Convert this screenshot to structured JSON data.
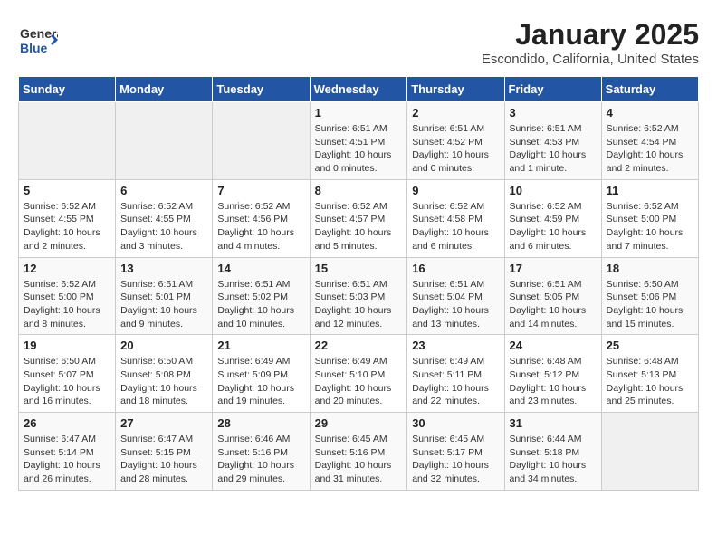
{
  "header": {
    "logo_general": "General",
    "logo_blue": "Blue",
    "month": "January 2025",
    "location": "Escondido, California, United States"
  },
  "weekdays": [
    "Sunday",
    "Monday",
    "Tuesday",
    "Wednesday",
    "Thursday",
    "Friday",
    "Saturday"
  ],
  "weeks": [
    [
      {
        "day": "",
        "info": ""
      },
      {
        "day": "",
        "info": ""
      },
      {
        "day": "",
        "info": ""
      },
      {
        "day": "1",
        "info": "Sunrise: 6:51 AM\nSunset: 4:51 PM\nDaylight: 10 hours\nand 0 minutes."
      },
      {
        "day": "2",
        "info": "Sunrise: 6:51 AM\nSunset: 4:52 PM\nDaylight: 10 hours\nand 0 minutes."
      },
      {
        "day": "3",
        "info": "Sunrise: 6:51 AM\nSunset: 4:53 PM\nDaylight: 10 hours\nand 1 minute."
      },
      {
        "day": "4",
        "info": "Sunrise: 6:52 AM\nSunset: 4:54 PM\nDaylight: 10 hours\nand 2 minutes."
      }
    ],
    [
      {
        "day": "5",
        "info": "Sunrise: 6:52 AM\nSunset: 4:55 PM\nDaylight: 10 hours\nand 2 minutes."
      },
      {
        "day": "6",
        "info": "Sunrise: 6:52 AM\nSunset: 4:55 PM\nDaylight: 10 hours\nand 3 minutes."
      },
      {
        "day": "7",
        "info": "Sunrise: 6:52 AM\nSunset: 4:56 PM\nDaylight: 10 hours\nand 4 minutes."
      },
      {
        "day": "8",
        "info": "Sunrise: 6:52 AM\nSunset: 4:57 PM\nDaylight: 10 hours\nand 5 minutes."
      },
      {
        "day": "9",
        "info": "Sunrise: 6:52 AM\nSunset: 4:58 PM\nDaylight: 10 hours\nand 6 minutes."
      },
      {
        "day": "10",
        "info": "Sunrise: 6:52 AM\nSunset: 4:59 PM\nDaylight: 10 hours\nand 6 minutes."
      },
      {
        "day": "11",
        "info": "Sunrise: 6:52 AM\nSunset: 5:00 PM\nDaylight: 10 hours\nand 7 minutes."
      }
    ],
    [
      {
        "day": "12",
        "info": "Sunrise: 6:52 AM\nSunset: 5:00 PM\nDaylight: 10 hours\nand 8 minutes."
      },
      {
        "day": "13",
        "info": "Sunrise: 6:51 AM\nSunset: 5:01 PM\nDaylight: 10 hours\nand 9 minutes."
      },
      {
        "day": "14",
        "info": "Sunrise: 6:51 AM\nSunset: 5:02 PM\nDaylight: 10 hours\nand 10 minutes."
      },
      {
        "day": "15",
        "info": "Sunrise: 6:51 AM\nSunset: 5:03 PM\nDaylight: 10 hours\nand 12 minutes."
      },
      {
        "day": "16",
        "info": "Sunrise: 6:51 AM\nSunset: 5:04 PM\nDaylight: 10 hours\nand 13 minutes."
      },
      {
        "day": "17",
        "info": "Sunrise: 6:51 AM\nSunset: 5:05 PM\nDaylight: 10 hours\nand 14 minutes."
      },
      {
        "day": "18",
        "info": "Sunrise: 6:50 AM\nSunset: 5:06 PM\nDaylight: 10 hours\nand 15 minutes."
      }
    ],
    [
      {
        "day": "19",
        "info": "Sunrise: 6:50 AM\nSunset: 5:07 PM\nDaylight: 10 hours\nand 16 minutes."
      },
      {
        "day": "20",
        "info": "Sunrise: 6:50 AM\nSunset: 5:08 PM\nDaylight: 10 hours\nand 18 minutes."
      },
      {
        "day": "21",
        "info": "Sunrise: 6:49 AM\nSunset: 5:09 PM\nDaylight: 10 hours\nand 19 minutes."
      },
      {
        "day": "22",
        "info": "Sunrise: 6:49 AM\nSunset: 5:10 PM\nDaylight: 10 hours\nand 20 minutes."
      },
      {
        "day": "23",
        "info": "Sunrise: 6:49 AM\nSunset: 5:11 PM\nDaylight: 10 hours\nand 22 minutes."
      },
      {
        "day": "24",
        "info": "Sunrise: 6:48 AM\nSunset: 5:12 PM\nDaylight: 10 hours\nand 23 minutes."
      },
      {
        "day": "25",
        "info": "Sunrise: 6:48 AM\nSunset: 5:13 PM\nDaylight: 10 hours\nand 25 minutes."
      }
    ],
    [
      {
        "day": "26",
        "info": "Sunrise: 6:47 AM\nSunset: 5:14 PM\nDaylight: 10 hours\nand 26 minutes."
      },
      {
        "day": "27",
        "info": "Sunrise: 6:47 AM\nSunset: 5:15 PM\nDaylight: 10 hours\nand 28 minutes."
      },
      {
        "day": "28",
        "info": "Sunrise: 6:46 AM\nSunset: 5:16 PM\nDaylight: 10 hours\nand 29 minutes."
      },
      {
        "day": "29",
        "info": "Sunrise: 6:45 AM\nSunset: 5:16 PM\nDaylight: 10 hours\nand 31 minutes."
      },
      {
        "day": "30",
        "info": "Sunrise: 6:45 AM\nSunset: 5:17 PM\nDaylight: 10 hours\nand 32 minutes."
      },
      {
        "day": "31",
        "info": "Sunrise: 6:44 AM\nSunset: 5:18 PM\nDaylight: 10 hours\nand 34 minutes."
      },
      {
        "day": "",
        "info": ""
      }
    ]
  ]
}
